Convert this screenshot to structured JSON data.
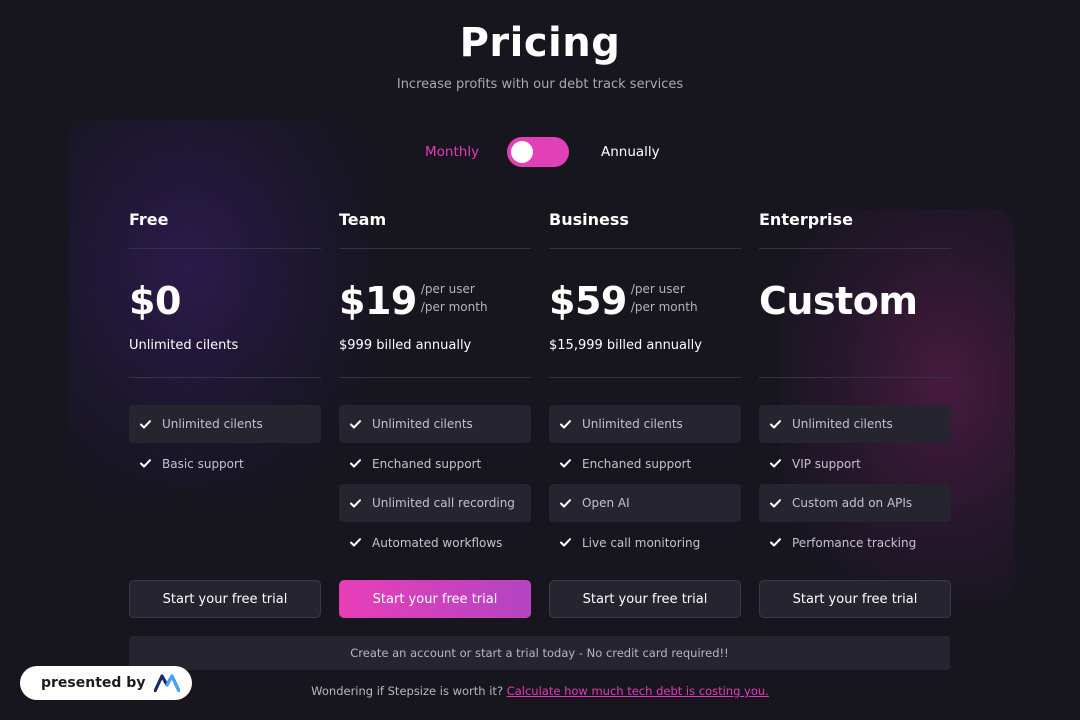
{
  "header": {
    "title": "Pricing",
    "subtitle": "Increase profits with our debt track services"
  },
  "billing": {
    "monthly_label": "Monthly",
    "annually_label": "Annually",
    "toggle_state": "monthly"
  },
  "plans": [
    {
      "name": "Free",
      "price": "$0",
      "per_line1": "",
      "per_line2": "",
      "billed": "Unlimited cilents",
      "features": [
        "Unlimited cilents",
        "Basic support"
      ],
      "cta": "Start your free trial",
      "highlighted": false
    },
    {
      "name": "Team",
      "price": "$19",
      "per_line1": "/per user",
      "per_line2": "/per month",
      "billed": "$999 billed annually",
      "features": [
        "Unlimited cilents",
        "Enchaned support",
        "Unlimited call recording",
        "Automated workflows"
      ],
      "cta": "Start your free trial",
      "highlighted": true
    },
    {
      "name": "Business",
      "price": "$59",
      "per_line1": "/per user",
      "per_line2": "/per month",
      "billed": "$15,999 billed annually",
      "features": [
        "Unlimited cilents",
        "Enchaned support",
        "Open AI",
        "Live call monitoring"
      ],
      "cta": "Start your free trial",
      "highlighted": false
    },
    {
      "name": "Enterprise",
      "price": "Custom",
      "per_line1": "",
      "per_line2": "",
      "billed": "",
      "features": [
        "Unlimited cilents",
        "VIP support",
        "Custom add on APIs",
        "Perfomance tracking"
      ],
      "cta": "Start your free trial",
      "highlighted": false
    }
  ],
  "banner": "Create an account or start a trial today - No credit card required!!",
  "footnote": {
    "text": "Wondering if Stepsize is worth it?",
    "link": "Calculate how much tech debt is costing you."
  },
  "badge": {
    "text": "presented by",
    "logo_icon": "m-logo-icon"
  },
  "colors": {
    "background": "#17161f",
    "accent": "#e43ab7",
    "card": "#25242f"
  },
  "icons": {
    "feature": "check-icon"
  }
}
